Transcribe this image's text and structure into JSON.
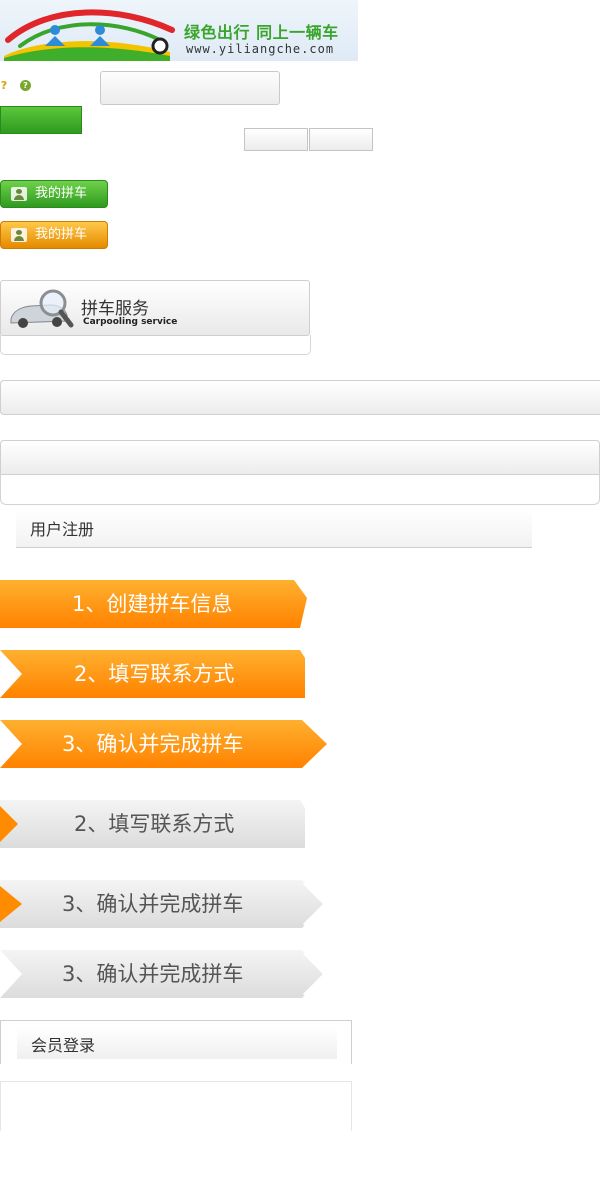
{
  "logo": {
    "slogan": "绿色出行 同上一辆车",
    "url": "www.yiliangche.com",
    "icon": "carpool-logo-icon"
  },
  "icons": {
    "key": "key-icon",
    "help": "help-icon",
    "key_glyph": "?",
    "help_glyph": "?"
  },
  "buttons": {
    "my_carpool_green": "我的拼车",
    "my_carpool_orange": "我的拼车"
  },
  "service": {
    "title": "拼车服务",
    "subtitle": "Carpooling service",
    "icon": "car-magnifier-icon"
  },
  "register": {
    "title": "用户注册"
  },
  "steps": [
    {
      "label": "1、创建拼车信息",
      "state": "active"
    },
    {
      "label": "2、填写联系方式",
      "state": "active"
    },
    {
      "label": "3、确认并完成拼车",
      "state": "active"
    },
    {
      "label": "2、填写联系方式",
      "state": "inactive"
    },
    {
      "label": "3、确认并完成拼车",
      "state": "inactive"
    },
    {
      "label": "3、确认并完成拼车",
      "state": "inactive"
    }
  ],
  "login": {
    "title": "会员登录"
  },
  "colors": {
    "green": "#3aa52d",
    "orange": "#ff8c00",
    "orange_light": "#ffb347",
    "grey": "#e6e6e6"
  }
}
